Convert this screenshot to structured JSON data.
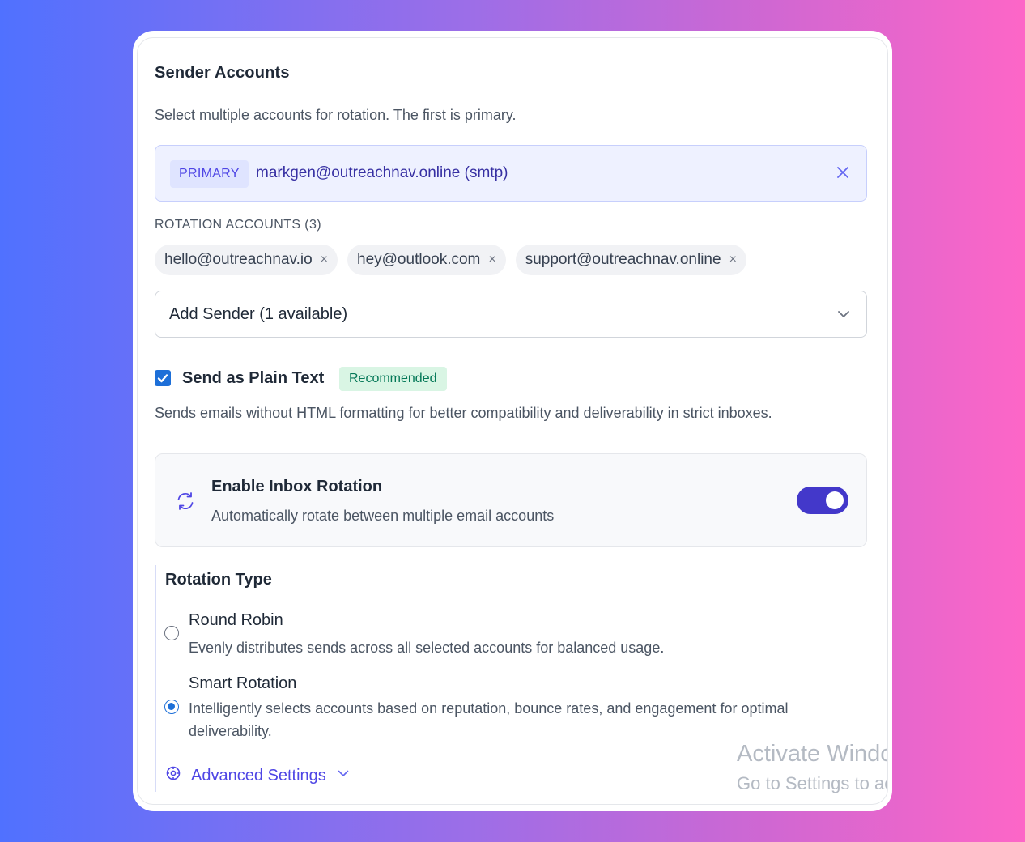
{
  "sender_accounts": {
    "title": "Sender Accounts",
    "description": "Select multiple accounts for rotation. The first is primary.",
    "primary": {
      "badge": "PRIMARY",
      "email": "markgen@outreachnav.online (smtp)",
      "remove_icon": "close-icon"
    },
    "rotation_label": "ROTATION ACCOUNTS (3)",
    "rotation_accounts": [
      {
        "email": "hello@outreachnav.io",
        "remove": "×"
      },
      {
        "email": "hey@outlook.com",
        "remove": "×"
      },
      {
        "email": "support@outreachnav.online",
        "remove": "×"
      }
    ],
    "add_sender": {
      "value": "Add Sender (1 available)",
      "icon": "chevron-down-icon"
    }
  },
  "plain_text": {
    "checked": true,
    "label": "Send as Plain Text",
    "badge": "Recommended",
    "description": "Sends emails without HTML formatting for better compatibility and deliverability in strict inboxes."
  },
  "inbox_rotation": {
    "icon": "refresh-icon",
    "title": "Enable Inbox Rotation",
    "description": "Automatically rotate between multiple email accounts",
    "enabled": true
  },
  "rotation_type": {
    "title": "Rotation Type",
    "options": [
      {
        "label": "Round Robin",
        "description": "Evenly distributes sends across all selected accounts for balanced usage.",
        "selected": false
      },
      {
        "label": "Smart Rotation",
        "description": "Intelligently selects accounts based on reputation, bounce rates, and engagement for optimal deliverability.",
        "selected": true
      }
    ]
  },
  "advanced_settings": {
    "label": "Advanced Settings",
    "icon": "settings-icon"
  },
  "watermark": {
    "line1": "Activate Windo",
    "line2": "Go to Settings to ac"
  },
  "colors": {
    "accent": "#4f46e5",
    "toggle_on": "#4338ca",
    "checkbox": "#1d6fd8",
    "badge_green_bg": "#d9f5e4",
    "badge_green_text": "#047857"
  }
}
